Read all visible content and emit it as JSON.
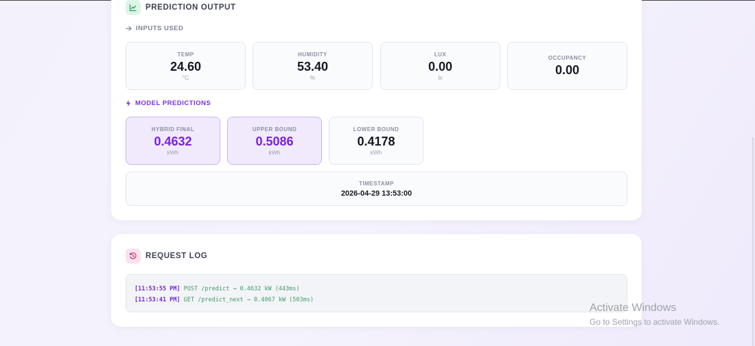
{
  "prediction_output": {
    "title": "PREDICTION OUTPUT",
    "inputs_label": "INPUTS USED",
    "inputs": [
      {
        "label": "TEMP",
        "value": "24.60",
        "unit": "°C"
      },
      {
        "label": "HUMIDITY",
        "value": "53.40",
        "unit": "%"
      },
      {
        "label": "LUX",
        "value": "0.00",
        "unit": "lx"
      },
      {
        "label": "OCCUPANCY",
        "value": "0.00",
        "unit": ""
      }
    ],
    "predictions_label": "MODEL PREDICTIONS",
    "predictions": [
      {
        "label": "HYBRID FINAL",
        "value": "0.4632",
        "unit": "kWh"
      },
      {
        "label": "UPPER BOUND",
        "value": "0.5086",
        "unit": "kWh"
      },
      {
        "label": "LOWER BOUND",
        "value": "0.4178",
        "unit": "kWh"
      }
    ],
    "timestamp_label": "TIMESTAMP",
    "timestamp_value": "2026-04-29 13:53:00"
  },
  "request_log": {
    "title": "REQUEST LOG",
    "entries": [
      {
        "time": "[11:53:55 PM]",
        "message": "POST /predict → 0.4632 kW (443ms)"
      },
      {
        "time": "[11:53:41 PM]",
        "message": "GET /predict_next → 0.4067 kW (503ms)"
      }
    ]
  },
  "watermark": {
    "line1": "Activate Windows",
    "line2": "Go to Settings to activate Windows."
  },
  "colors": {
    "accent_purple": "#7a20dd",
    "log_green": "#3f9a6c",
    "icon_green_bg": "#dcf5e6",
    "icon_pink_bg": "#fbe1ee"
  }
}
